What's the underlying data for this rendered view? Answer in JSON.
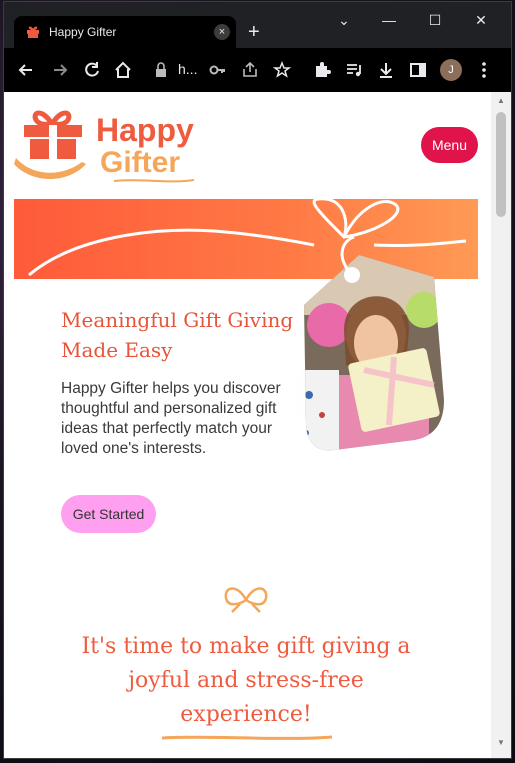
{
  "browser": {
    "tab_title": "Happy Gifter",
    "tab_close": "×",
    "new_tab": "+",
    "address_text": "h...",
    "profile_initial": "J",
    "window_controls": [
      "⌄",
      "—",
      "☐",
      "✕"
    ]
  },
  "site": {
    "logo_line1": "Happy",
    "logo_line2": "Gifter",
    "menu_label": "Menu",
    "hero_title": "Meaningful Gift Giving Made Easy",
    "hero_body": "Happy Gifter helps you discover thoughtful and personalized gift ideas that perfectly match your loved one's interests.",
    "cta_label": "Get Started",
    "tagline": "It's time to make gift giving a joyful and stress-free experience!"
  },
  "colors": {
    "brand_red": "#ef5b3f",
    "brand_orange": "#f4a65a",
    "menu_bg": "#e0134a",
    "cta_bg": "#ff9ff0"
  },
  "icons": [
    "gift-favicon-icon",
    "back-icon",
    "forward-icon",
    "reload-icon",
    "home-icon",
    "lock-icon",
    "key-icon",
    "share-icon",
    "star-icon",
    "extensions-icon",
    "media-icon",
    "download-icon",
    "sidepanel-icon",
    "more-icon",
    "gift-logo-icon",
    "bow-icon"
  ]
}
